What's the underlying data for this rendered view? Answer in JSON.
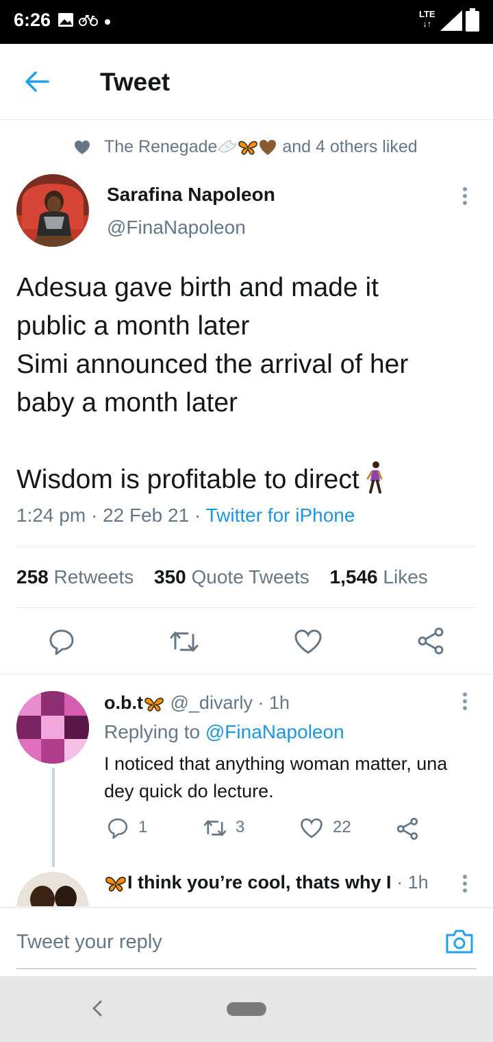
{
  "status_bar": {
    "time": "6:26",
    "network": "LTE"
  },
  "header": {
    "title": "Tweet"
  },
  "social_context": {
    "text_before": "The Renegade",
    "text_after": "and 4 others liked"
  },
  "tweet": {
    "author_name": "Sarafina Napoleon",
    "author_handle": "@FinaNapoleon",
    "lines": [
      "Adesua gave birth and made it",
      "public a month later",
      "Simi announced the arrival of her",
      "baby a month later",
      "",
      "Wisdom is profitable to direct"
    ],
    "time": "1:24 pm",
    "date": "22 Feb 21",
    "source": "Twitter for iPhone",
    "retweets_count": "258",
    "retweets_label": "Retweets",
    "quotes_count": "350",
    "quotes_label": "Quote Tweets",
    "likes_count": "1,546",
    "likes_label": "Likes"
  },
  "replies": [
    {
      "name": "o.b.t",
      "handle": "@_divarly",
      "time": "1h",
      "replying_label": "Replying to",
      "replying_to": "@FinaNapoleon",
      "text": "I noticed that anything woman matter, una dey quick do lecture.",
      "reply_count": "1",
      "retweet_count": "3",
      "like_count": "22"
    },
    {
      "name": "I think you’re cool, thats why I",
      "time": "1h"
    }
  ],
  "compose": {
    "placeholder": "Tweet your reply"
  },
  "colors": {
    "accent": "#1da1f2",
    "link": "#1b95e0",
    "secondary_text": "#657786",
    "divider": "#e1e8ed"
  },
  "icons": [
    "back-arrow-icon",
    "heart-icon",
    "more-icon",
    "reply-icon",
    "retweet-icon",
    "like-icon",
    "share-icon",
    "camera-icon",
    "butterfly-emoji",
    "dove-emoji",
    "brown-heart-emoji",
    "walking-woman-emoji"
  ]
}
